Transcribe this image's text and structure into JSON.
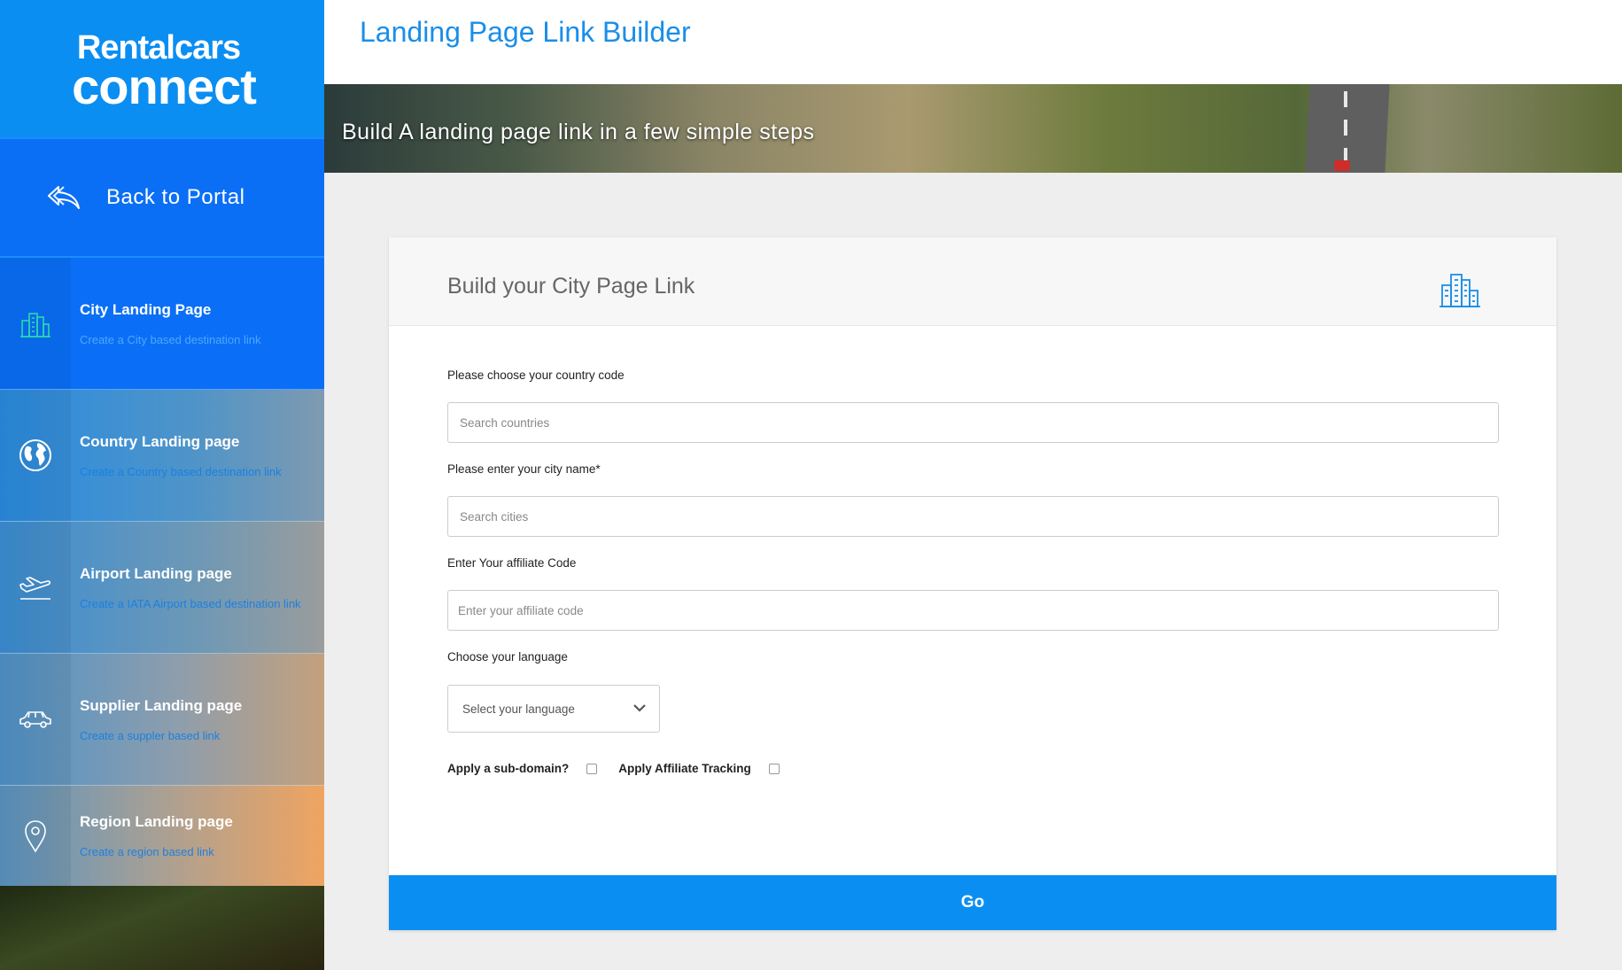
{
  "brand": {
    "line1": "Rentalcars",
    "line2": "connect"
  },
  "back": {
    "label": "Back to Portal"
  },
  "header": {
    "title": "Landing Page Link Builder"
  },
  "banner": {
    "subtitle": "Build A landing page link in a few simple steps"
  },
  "nav": {
    "items": [
      {
        "title": "City Landing Page",
        "desc": "Create a City based destination link",
        "icon": "city-icon"
      },
      {
        "title": "Country Landing page",
        "desc": "Create a Country based destination link",
        "icon": "globe-icon"
      },
      {
        "title": "Airport Landing page",
        "desc": "Create a IATA Airport based destination link",
        "icon": "plane-icon"
      },
      {
        "title": "Supplier Landing page",
        "desc": "Create a suppler based link",
        "icon": "car-icon"
      },
      {
        "title": "Region Landing page",
        "desc": "Create a region based link",
        "icon": "map-pin-icon"
      }
    ]
  },
  "card": {
    "title": "Build your City Page Link",
    "icon": "city-icon",
    "fields": {
      "country": {
        "label": "Please choose your country code",
        "placeholder": "Search countries",
        "value": ""
      },
      "city": {
        "label": "Please enter your city name*",
        "placeholder": "Search cities",
        "value": ""
      },
      "affiliate": {
        "label": "Enter Your affiliate Code",
        "placeholder": "Enter your affiliate code",
        "value": ""
      },
      "language": {
        "label": "Choose your language",
        "selected": "Select your language"
      }
    },
    "checkboxes": {
      "subdomain": {
        "label": "Apply a sub-domain?",
        "checked": false
      },
      "tracking": {
        "label": "Apply Affiliate Tracking",
        "checked": false
      }
    },
    "go_label": "Go"
  },
  "colors": {
    "accent": "#0b8ef2",
    "nav_active": "#0a6ff6",
    "title": "#1a8ee8"
  }
}
